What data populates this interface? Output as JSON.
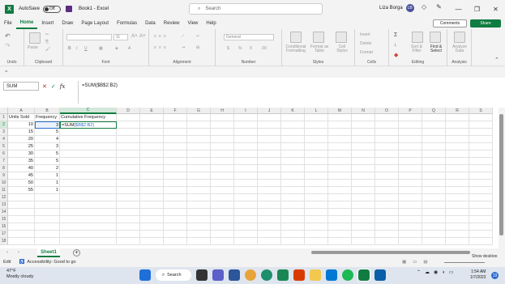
{
  "titlebar": {
    "autosave_label": "AutoSave",
    "toggle_state": "Off",
    "doc_title": "Book1 - Excel",
    "search_placeholder": "Search",
    "user_name": "Liza Borga",
    "user_initials": "LB",
    "minimize": "—",
    "restore": "❐",
    "close": "✕"
  },
  "menu": {
    "tabs": [
      "File",
      "Home",
      "Insert",
      "Draw",
      "Page Layout",
      "Formulas",
      "Data",
      "Review",
      "View",
      "Help"
    ],
    "active": "Home",
    "comments_label": "Comments",
    "share_label": "Share"
  },
  "ribbon": {
    "groups": [
      "Undo",
      "Clipboard",
      "Font",
      "Alignment",
      "Number",
      "Styles",
      "Cells",
      "Editing",
      "Analysis"
    ],
    "paste_label": "Paste",
    "font_size": "11",
    "number_format": "General",
    "styles_items": [
      "Conditional Formatting",
      "Format as Table",
      "Cell Styles"
    ],
    "cells_items": [
      "Insert",
      "Delete",
      "Format"
    ],
    "editing_items": [
      "Sort & Filter",
      "Find & Select"
    ],
    "analysis_items": [
      "Analyze Data"
    ]
  },
  "strip": {
    "text": "="
  },
  "formula": {
    "name_box": "SUM",
    "value": "=SUM($B$2:B2)"
  },
  "grid": {
    "columns": [
      "A",
      "B",
      "C",
      "D",
      "E",
      "F",
      "G",
      "H",
      "I",
      "J",
      "K",
      "L",
      "M",
      "N",
      "O",
      "P",
      "Q",
      "R",
      "S"
    ],
    "rows": [
      "1",
      "2",
      "3",
      "4",
      "5",
      "6",
      "7",
      "8",
      "9",
      "10",
      "11",
      "12",
      "13",
      "14",
      "15",
      "16",
      "17",
      "18"
    ],
    "headers": [
      "Units Sold",
      "Frequency",
      "Cumulative Frequency"
    ],
    "data": [
      [
        "10",
        "3"
      ],
      [
        "15",
        "5"
      ],
      [
        "20",
        "4"
      ],
      [
        "25",
        "3"
      ],
      [
        "30",
        "5"
      ],
      [
        "35",
        "5"
      ],
      [
        "40",
        "2"
      ],
      [
        "45",
        "1"
      ],
      [
        "50",
        "1"
      ],
      [
        "55",
        "1"
      ]
    ],
    "active_formula_prefix": "=SUM(",
    "active_formula_ref": "$B$2:B2)"
  },
  "sheets": {
    "tabs": [
      "Sheet1"
    ],
    "add": "+",
    "show_desktop": "Show desktop"
  },
  "status": {
    "mode": "Edit",
    "accessibility": "Accessibility: Good to go"
  },
  "taskbar": {
    "temp": "47°F",
    "weather": "Mostly cloudy",
    "search": "Search",
    "time": "1:54 AM",
    "date": "1/7/2023",
    "notif": "19"
  },
  "colors": {
    "accent": "#107c41",
    "ref": "#2a70c9"
  }
}
